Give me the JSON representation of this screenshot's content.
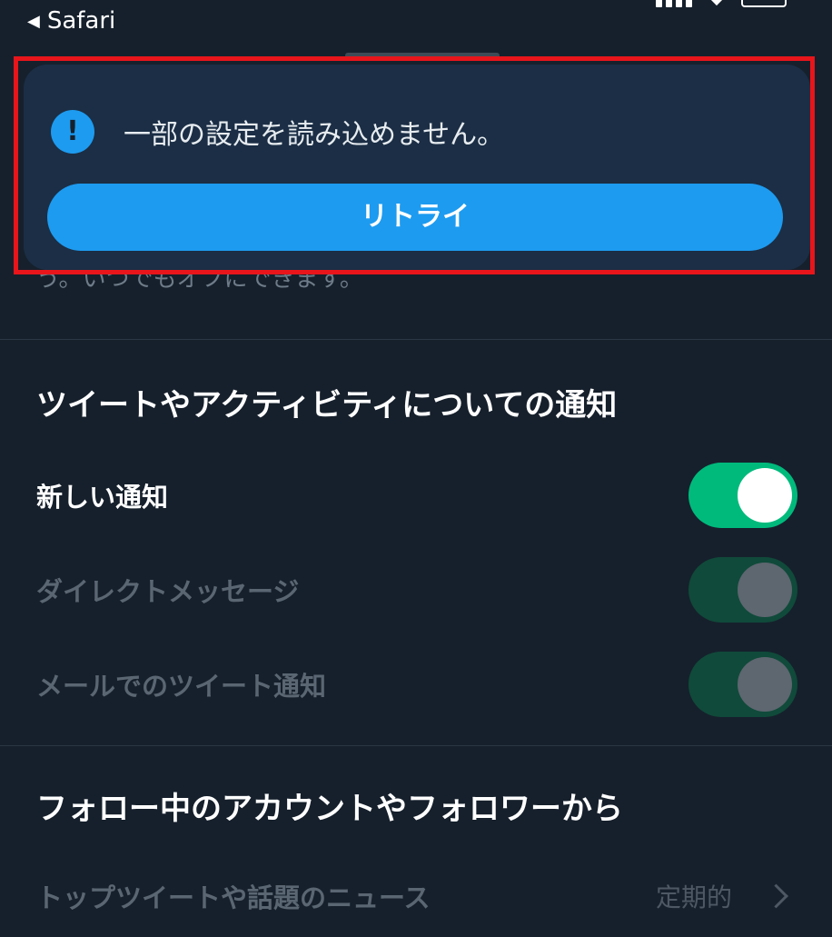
{
  "status_bar": {
    "back_label": "Safari"
  },
  "background_hint_text": "う。いつでもオフにできます。",
  "error_overlay": {
    "message": "一部の設定を読み込めません。",
    "retry_label": "リトライ"
  },
  "sections": [
    {
      "title": "ツイートやアクティビティについての通知",
      "rows": [
        {
          "label": "新しい通知",
          "state": "on"
        },
        {
          "label": "ダイレクトメッセージ",
          "state": "disabled-on"
        },
        {
          "label": "メールでのツイート通知",
          "state": "disabled-on"
        }
      ]
    },
    {
      "title": "フォロー中のアカウントやフォロワーから",
      "rows": [
        {
          "label": "トップツイートや話題のニュース",
          "value": "定期的"
        }
      ]
    }
  ],
  "colors": {
    "background": "#16202c",
    "accent_blue": "#1d9bf0",
    "toggle_green": "#00ba7c",
    "highlight_red": "#e8151b"
  }
}
